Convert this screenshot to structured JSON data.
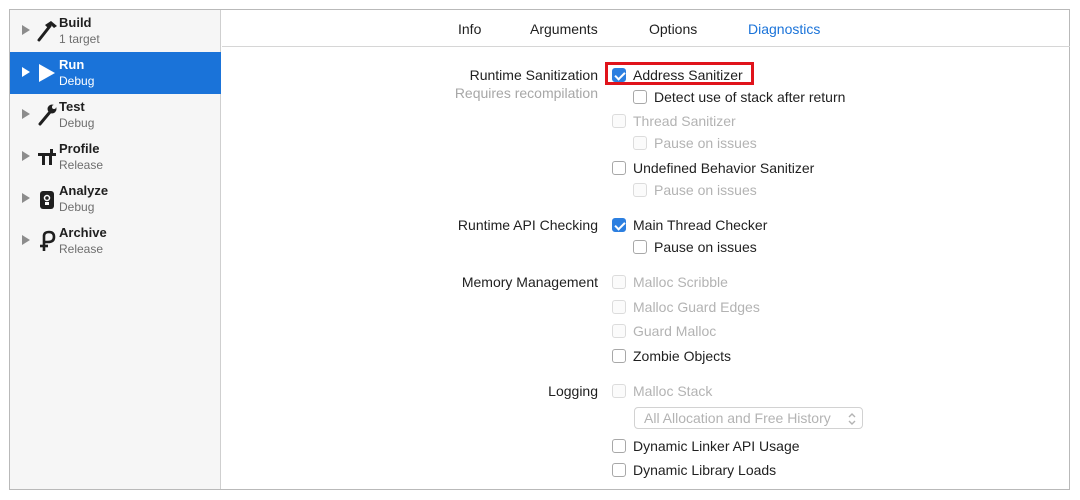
{
  "sidebar": {
    "items": [
      {
        "title": "Build",
        "subtitle": "1 target",
        "icon": "hammer-icon"
      },
      {
        "title": "Run",
        "subtitle": "Debug",
        "icon": "play-icon"
      },
      {
        "title": "Test",
        "subtitle": "Debug",
        "icon": "wrench-icon"
      },
      {
        "title": "Profile",
        "subtitle": "Release",
        "icon": "caliper-icon"
      },
      {
        "title": "Analyze",
        "subtitle": "Debug",
        "icon": "analyze-icon"
      },
      {
        "title": "Archive",
        "subtitle": "Release",
        "icon": "archive-icon"
      }
    ],
    "selected": "Run"
  },
  "tabs": {
    "items": [
      "Info",
      "Arguments",
      "Options",
      "Diagnostics"
    ],
    "selected": "Diagnostics"
  },
  "sections": {
    "runtime_sanitization": {
      "label": "Runtime Sanitization",
      "hint": "Requires recompilation",
      "options": [
        {
          "label": "Address Sanitizer",
          "checked": true,
          "enabled": true
        },
        {
          "label": "Detect use of stack after return",
          "checked": false,
          "enabled": true
        },
        {
          "label": "Thread Sanitizer",
          "checked": false,
          "enabled": false
        },
        {
          "label": "Pause on issues",
          "checked": false,
          "enabled": false
        },
        {
          "label": "Undefined Behavior Sanitizer",
          "checked": false,
          "enabled": true
        },
        {
          "label": "Pause on issues",
          "checked": false,
          "enabled": false
        }
      ]
    },
    "runtime_api_checking": {
      "label": "Runtime API Checking",
      "options": [
        {
          "label": "Main Thread Checker",
          "checked": true,
          "enabled": true
        },
        {
          "label": "Pause on issues",
          "checked": false,
          "enabled": true
        }
      ]
    },
    "memory_management": {
      "label": "Memory Management",
      "options": [
        {
          "label": "Malloc Scribble",
          "checked": false,
          "enabled": false
        },
        {
          "label": "Malloc Guard Edges",
          "checked": false,
          "enabled": false
        },
        {
          "label": "Guard Malloc",
          "checked": false,
          "enabled": false
        },
        {
          "label": "Zombie Objects",
          "checked": false,
          "enabled": true
        }
      ]
    },
    "logging": {
      "label": "Logging",
      "malloc_stack": {
        "label": "Malloc Stack",
        "checked": false,
        "enabled": false
      },
      "history_popup": {
        "value": "All Allocation and Free History",
        "enabled": false
      },
      "options": [
        {
          "label": "Dynamic Linker API Usage",
          "checked": false,
          "enabled": true
        },
        {
          "label": "Dynamic Library Loads",
          "checked": false,
          "enabled": true
        }
      ]
    }
  },
  "colors": {
    "accent": "#1a73d9",
    "highlight": "#e0131b"
  }
}
